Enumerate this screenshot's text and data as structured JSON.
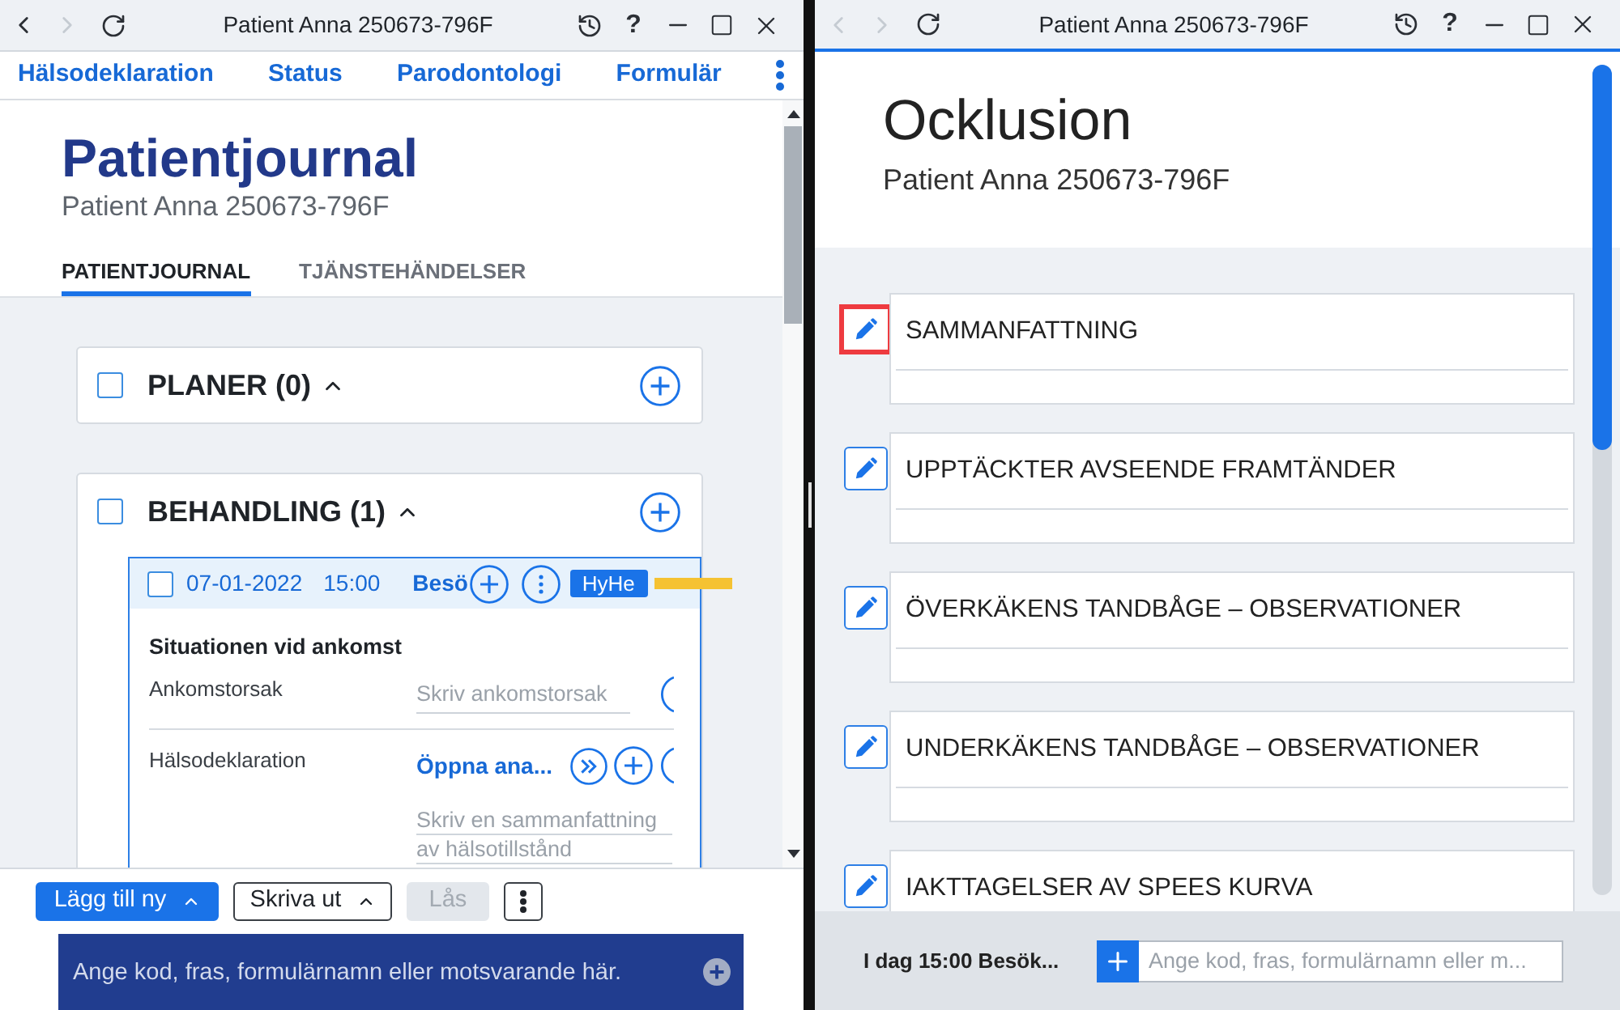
{
  "left_window": {
    "active": false,
    "title_bar": {
      "title": "Patient Anna 250673-796F",
      "back_enabled": true,
      "forward_enabled": false,
      "help": "?"
    },
    "nav_menu": [
      {
        "label": "Hälsodeklaration"
      },
      {
        "label": "Status"
      },
      {
        "label": "Parodontologi"
      },
      {
        "label": "Formulär"
      }
    ],
    "header": {
      "title": "Patientjournal",
      "subtitle": "Patient Anna 250673-796F"
    },
    "tabs": [
      {
        "label": "PATIENTJOURNAL",
        "selected": true
      },
      {
        "label": "TJÄNSTEHÄNDELSER",
        "selected": false
      }
    ],
    "groups": [
      {
        "title": "PLANER (0)",
        "checked": false,
        "expanded": true
      },
      {
        "title": "BEHANDLING (1)",
        "checked": false,
        "expanded": true,
        "entries": [
          {
            "checked": false,
            "date": "07-01-2022",
            "time": "15:00",
            "type": "Besö",
            "badge": "HyHe",
            "color": "#f5c232",
            "section": "Situationen vid ankomst",
            "fields": [
              {
                "kind": "input",
                "label": "Ankomstorsak",
                "placeholder": "Skriv ankomstorsak"
              },
              {
                "kind": "link",
                "label": "Hälsodeklaration",
                "link": "Öppna ana...",
                "placeholder": "Skriv en sammanfattning av hälsotillstånd"
              }
            ]
          }
        ]
      }
    ],
    "toolbar": [
      {
        "kind": "primary",
        "label": "Lägg till ny",
        "menu": true,
        "disabled": false
      },
      {
        "kind": "outline",
        "label": "Skriva ut",
        "menu": true,
        "disabled": false
      },
      {
        "kind": "outline",
        "label": "Lås",
        "menu": false,
        "disabled": true
      },
      {
        "kind": "more",
        "disabled": false
      }
    ],
    "command_bar": {
      "placeholder": "Ange kod, fras, formulärnamn eller motsvarande här."
    }
  },
  "right_window": {
    "active": true,
    "title_bar": {
      "title": "Patient Anna 250673-796F",
      "back_enabled": false,
      "forward_enabled": false,
      "help": "?"
    },
    "header": {
      "title": "Ocklusion",
      "subtitle": "Patient Anna 250673-796F"
    },
    "sections": [
      {
        "title": "SAMMANFATTNING",
        "highlighted": true
      },
      {
        "title": "UPPTÄCKTER AVSEENDE FRAMTÄNDER",
        "highlighted": false
      },
      {
        "title": "ÖVERKÄKENS TANDBÅGE – OBSERVATIONER",
        "highlighted": false
      },
      {
        "title": "UNDERKÄKENS TANDBÅGE – OBSERVATIONER",
        "highlighted": false
      },
      {
        "title": "IAKTTAGELSER AV SPEES KURVA",
        "highlighted": false
      }
    ],
    "footer": {
      "status": "I dag 15:00 Besök...",
      "placeholder": "Ange kod, fras, formulärnamn eller m..."
    }
  }
}
